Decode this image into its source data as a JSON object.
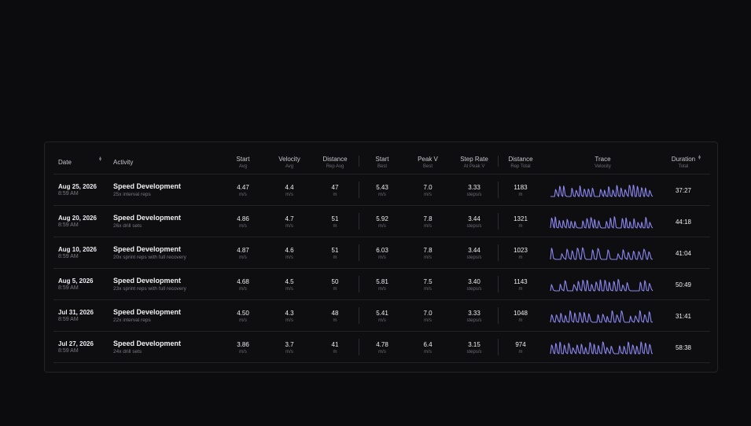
{
  "columns": {
    "date": {
      "main": "Date"
    },
    "activity": {
      "main": "Activity"
    },
    "start_avg": {
      "main": "Start",
      "sub": "Avg"
    },
    "velocity_avg": {
      "main": "Velocity",
      "sub": "Avg"
    },
    "distance_rep_avg": {
      "main": "Distance",
      "sub": "Rep Avg"
    },
    "start_best": {
      "main": "Start",
      "sub": "Best"
    },
    "peak_v_best": {
      "main": "Peak V",
      "sub": "Best"
    },
    "step_rate": {
      "main": "Step Rate",
      "sub": "At Peak V"
    },
    "distance_total": {
      "main": "Distance",
      "sub": "Rep Total"
    },
    "trace": {
      "main": "Trace",
      "sub": "Velocity"
    },
    "duration": {
      "main": "Duration",
      "sub": "Total"
    }
  },
  "units": {
    "speed": "m/s",
    "distance": "m",
    "step_rate": "steps/s"
  },
  "trace_color": "#8b87f0",
  "rows": [
    {
      "date": "Aug 25, 2026",
      "time": "8:59 AM",
      "activity": "Speed Development",
      "detail": "25x interval reps",
      "start_avg": "4.47",
      "velocity_avg": "4.4",
      "distance_avg": "47",
      "start_best": "5.43",
      "peak_v": "7.0",
      "step_rate": "3.33",
      "distance_total": "1183",
      "duration": "37:27",
      "reps": 25
    },
    {
      "date": "Aug 20, 2026",
      "time": "8:59 AM",
      "activity": "Speed Development",
      "detail": "26x drill sets",
      "start_avg": "4.86",
      "velocity_avg": "4.7",
      "distance_avg": "51",
      "start_best": "5.92",
      "peak_v": "7.8",
      "step_rate": "3.44",
      "distance_total": "1321",
      "duration": "44:18",
      "reps": 26
    },
    {
      "date": "Aug 10, 2026",
      "time": "8:59 AM",
      "activity": "Speed Development",
      "detail": "20x sprint reps with full recovery",
      "start_avg": "4.87",
      "velocity_avg": "4.6",
      "distance_avg": "51",
      "start_best": "6.03",
      "peak_v": "7.8",
      "step_rate": "3.44",
      "distance_total": "1023",
      "duration": "41:04",
      "reps": 20
    },
    {
      "date": "Aug 5, 2026",
      "time": "8:59 AM",
      "activity": "Speed Development",
      "detail": "23x sprint reps with full recovery",
      "start_avg": "4.68",
      "velocity_avg": "4.5",
      "distance_avg": "50",
      "start_best": "5.81",
      "peak_v": "7.5",
      "step_rate": "3.40",
      "distance_total": "1143",
      "duration": "50:49",
      "reps": 23
    },
    {
      "date": "Jul 31, 2026",
      "time": "8:59 AM",
      "activity": "Speed Development",
      "detail": "22x interval reps",
      "start_avg": "4.50",
      "velocity_avg": "4.3",
      "distance_avg": "48",
      "start_best": "5.41",
      "peak_v": "7.0",
      "step_rate": "3.33",
      "distance_total": "1048",
      "duration": "31:41",
      "reps": 22
    },
    {
      "date": "Jul 27, 2026",
      "time": "8:59 AM",
      "activity": "Speed Development",
      "detail": "24x drill sets",
      "start_avg": "3.86",
      "velocity_avg": "3.7",
      "distance_avg": "41",
      "start_best": "4.78",
      "peak_v": "6.4",
      "step_rate": "3.15",
      "distance_total": "974",
      "duration": "58:38",
      "reps": 24
    }
  ]
}
